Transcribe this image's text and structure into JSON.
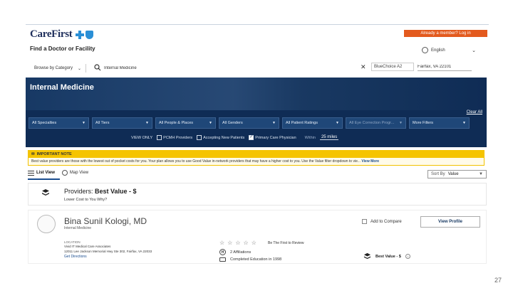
{
  "header": {
    "logo_text": "CareFirst",
    "login_label": "Already a member? Log in",
    "page_title": "Find a Doctor or Facility",
    "language": "English"
  },
  "search": {
    "browse_label": "Browse by Category",
    "query": "Internal Medicine",
    "plan": "BlueChoice A2",
    "location": "Fairfax, VA 22101"
  },
  "banner": {
    "title": "Internal Medicine",
    "clear_all": "Clear All",
    "filters": [
      {
        "label": "All Specialties",
        "disabled": false
      },
      {
        "label": "All Tiers",
        "disabled": false
      },
      {
        "label": "All People & Places",
        "disabled": false
      },
      {
        "label": "All Genders",
        "disabled": false
      },
      {
        "label": "All Patient Ratings",
        "disabled": false
      },
      {
        "label": "All Eye Correction Progr...",
        "disabled": true
      },
      {
        "label": "More Filters",
        "disabled": false
      }
    ],
    "view_only_label": "VIEW ONLY",
    "opt_pcmh": "PCMH Providers",
    "opt_accepting": "Accepting New Patients",
    "opt_pcp": "Primary Care Physician",
    "within_label": "Within",
    "within_value": "25 miles"
  },
  "notice": {
    "title": "IMPORTANT NOTE",
    "body": "Best value providers are those with the lowest out of pocket costs for you. Your plan allows you to use Good Value in-network providers that may have a higher cost to you. Use the Value filter dropdown to vie... ",
    "more": "View More"
  },
  "views": {
    "list": "List View",
    "map": "Map View",
    "sort_label": "Sort By",
    "sort_value": "Value"
  },
  "providers": {
    "title_prefix": "Providers:",
    "title_value": "Best Value - $",
    "subtitle": "Lower Cost to You Why?"
  },
  "card": {
    "name": "Bina Sunil Kologi, MD",
    "specialty": "Internal Medicine",
    "compare": "Add to Compare",
    "view_profile": "View Profile",
    "location_label": "LOCATION",
    "location_name": "Vivid IT Medical Care Associates",
    "address": "12011 Lee Jackson Memorial Hwy Ste 302, Fairfax, VA 22033",
    "directions": "Get Directions",
    "review": "Be The First to Review",
    "affiliations": "2 Affiliations",
    "education": "Completed Education in 1998",
    "badge": "Best Value - $"
  },
  "slide_number": "27"
}
